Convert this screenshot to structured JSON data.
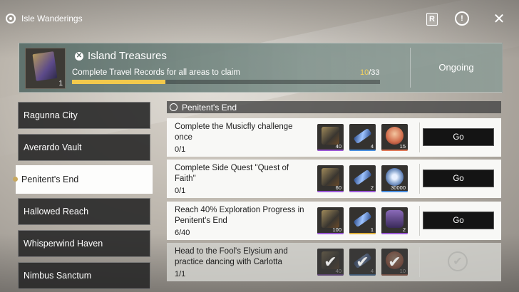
{
  "header": {
    "title": "Isle Wanderings",
    "icons": [
      "map-pin-icon",
      "r-key-icon",
      "alert-icon",
      "close-icon"
    ]
  },
  "banner": {
    "reward_count": "1",
    "title": "Island Treasures",
    "subtitle": "Complete Travel Records for all areas to claim",
    "progress_current": "10",
    "progress_total": "/33",
    "progress_fraction": 0.303,
    "status": "Ongoing"
  },
  "sidebar": {
    "items": [
      {
        "label": "Ragunna City"
      },
      {
        "label": "Averardo Vault"
      },
      {
        "label": "Penitent's End"
      },
      {
        "label": "Hallowed Reach"
      },
      {
        "label": "Whisperwind Haven"
      },
      {
        "label": "Nimbus Sanctum"
      }
    ],
    "active_index": 2
  },
  "section": {
    "title": "Penitent's End"
  },
  "tasks": [
    {
      "desc": "Complete the Musicfly challenge once",
      "progress": "0/1",
      "rewards": [
        {
          "icon": "book-icon",
          "count": "40",
          "quality": "#9b59d6"
        },
        {
          "icon": "crystal-tube-icon",
          "count": "4",
          "quality": "#4a8fe0"
        },
        {
          "icon": "chest-icon",
          "count": "15",
          "quality": "#e07a5a"
        }
      ],
      "button": "Go"
    },
    {
      "desc": "Complete Side Quest \"Quest of Faith\"",
      "progress": "0/1",
      "rewards": [
        {
          "icon": "book-icon",
          "count": "60",
          "quality": "#9b59d6"
        },
        {
          "icon": "crystal-tube-icon",
          "count": "2",
          "quality": "#9b59d6"
        },
        {
          "icon": "shell-coin-icon",
          "count": "30000",
          "quality": "#4a8fe0"
        }
      ],
      "button": "Go"
    },
    {
      "desc": "Reach 40% Exploration Progress in Penitent's End",
      "progress": "6/40",
      "rewards": [
        {
          "icon": "book-icon",
          "count": "100",
          "quality": "#9b59d6"
        },
        {
          "icon": "crystal-tube-icon",
          "count": "1",
          "quality": "#e0b13a"
        },
        {
          "icon": "device-icon",
          "count": "2",
          "quality": "#9b59d6"
        }
      ],
      "button": "Go"
    },
    {
      "desc": "Head to the Fool's Elysium and practice dancing with Carlotta",
      "progress": "1/1",
      "rewards": [
        {
          "icon": "book-icon",
          "count": "40",
          "quality": "#9b59d6"
        },
        {
          "icon": "crystal-tube-icon",
          "count": "4",
          "quality": "#4a8fe0"
        },
        {
          "icon": "chest-icon",
          "count": "10",
          "quality": "#e07a5a"
        }
      ],
      "completed": true
    }
  ]
}
